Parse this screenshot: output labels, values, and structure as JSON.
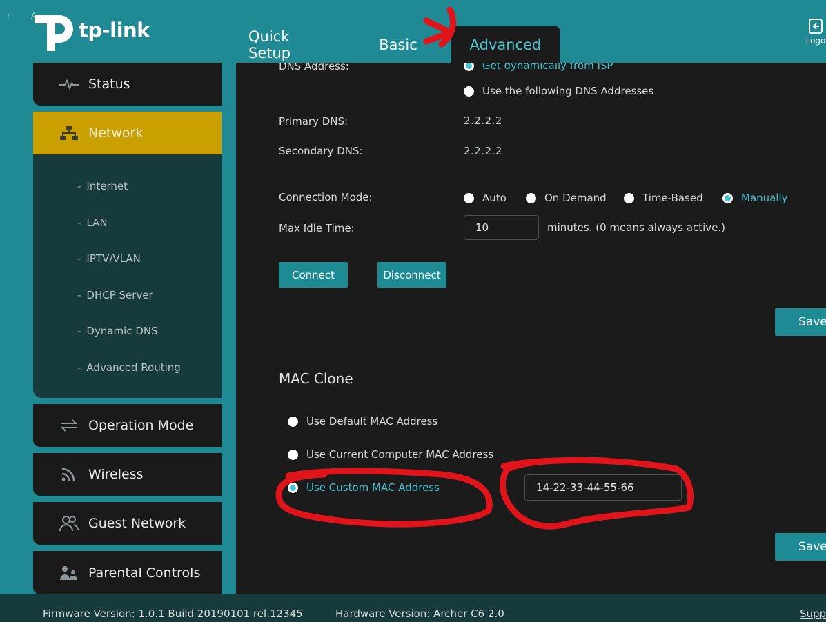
{
  "header": {
    "corner_chars": [
      "r",
      "A"
    ],
    "logo_text": "tp-link",
    "tabs": [
      {
        "label": "Quick Setup"
      },
      {
        "label": "Basic"
      },
      {
        "label": "Advanced",
        "active": true
      }
    ],
    "logout_label": "Logo"
  },
  "sidebar": {
    "items": [
      {
        "label": "Status",
        "icon": "pulse-icon"
      },
      {
        "label": "Network",
        "icon": "network-icon",
        "active": true
      },
      {
        "label": "Operation Mode",
        "icon": "swap-icon"
      },
      {
        "label": "Wireless",
        "icon": "wifi-icon"
      },
      {
        "label": "Guest Network",
        "icon": "guests-icon"
      },
      {
        "label": "Parental Controls",
        "icon": "family-icon"
      }
    ],
    "network_sub": [
      "Internet",
      "LAN",
      "IPTV/VLAN",
      "DHCP Server",
      "Dynamic DNS",
      "Advanced Routing"
    ]
  },
  "dns": {
    "label": "DNS Address:",
    "option_dynamic": "Get dynamically from ISP",
    "option_manual": "Use the following DNS Addresses",
    "selected": "dynamic",
    "primary_label": "Primary DNS:",
    "primary_value": "2.2.2.2",
    "secondary_label": "Secondary DNS:",
    "secondary_value": "2.2.2.2"
  },
  "connection": {
    "label": "Connection Mode:",
    "options": [
      "Auto",
      "On Demand",
      "Time-Based",
      "Manually"
    ],
    "selected": "Manually",
    "idle_label": "Max Idle Time:",
    "idle_value": "10",
    "idle_suffix": "minutes. (0 means always active.)",
    "connect_label": "Connect",
    "disconnect_label": "Disconnect",
    "save_label": "Save"
  },
  "mac_clone": {
    "title": "MAC Clone",
    "option_default": "Use Default MAC Address",
    "option_current": "Use Current Computer MAC Address",
    "option_custom": "Use Custom MAC Address",
    "selected": "custom",
    "custom_value": "14-22-33-44-55-66",
    "save_label": "Save"
  },
  "footer": {
    "firmware": "Firmware Version: 1.0.1 Build 20190101 rel.12345",
    "hardware": "Hardware Version: Archer C6 2.0",
    "support": "Suppo"
  },
  "colors": {
    "accent": "#47c2cf",
    "header_bg": "#1f8a94",
    "active_nav": "#c9a000",
    "annotation": "#e0151b"
  }
}
